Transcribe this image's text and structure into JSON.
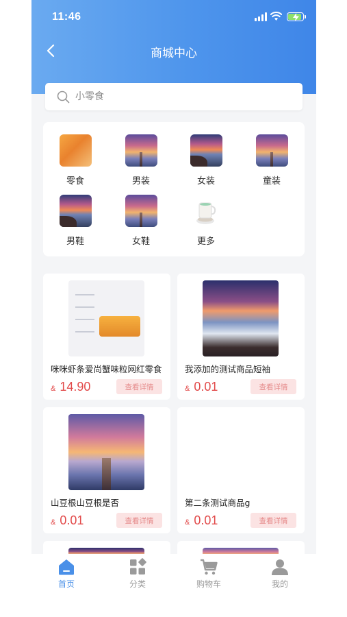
{
  "status_bar": {
    "time": "11:46"
  },
  "header": {
    "title": "商城中心"
  },
  "search": {
    "placeholder": "小零食"
  },
  "categories": [
    {
      "label": "零食",
      "icon": "snack-image"
    },
    {
      "label": "男装",
      "icon": "sunset-pier-image"
    },
    {
      "label": "女装",
      "icon": "sunset-rock-image"
    },
    {
      "label": "童装",
      "icon": "sunset-pier-image"
    },
    {
      "label": "男鞋",
      "icon": "sunset-rock-image"
    },
    {
      "label": "女鞋",
      "icon": "sunset-pier-image"
    },
    {
      "label": "更多",
      "icon": "cup-image"
    }
  ],
  "products": [
    {
      "title": "咪咪虾条爱尚蟹味粒网红零食",
      "currency": "&",
      "price": "14.90",
      "button": "查看详情",
      "image": "snack-product-image"
    },
    {
      "title": "我添加的测试商品短袖",
      "currency": "&",
      "price": "0.01",
      "button": "查看详情",
      "image": "seascape-image"
    },
    {
      "title": "山豆根山豆根是否",
      "currency": "&",
      "price": "0.01",
      "button": "查看详情",
      "image": "pier-sunset-image"
    },
    {
      "title": "第二条测试商品g",
      "currency": "&",
      "price": "0.01",
      "button": "查看详情",
      "image": ""
    }
  ],
  "tabbar": [
    {
      "label": "首页",
      "icon": "home-icon",
      "active": true
    },
    {
      "label": "分类",
      "icon": "category-icon",
      "active": false
    },
    {
      "label": "购物车",
      "icon": "cart-icon",
      "active": false
    },
    {
      "label": "我的",
      "icon": "user-icon",
      "active": false
    }
  ],
  "colors": {
    "header_start": "#6aaaf0",
    "header_end": "#3f86e8",
    "price": "#e24a4a",
    "active_tab": "#4a90e8",
    "inactive_tab": "#9a9a9a"
  }
}
